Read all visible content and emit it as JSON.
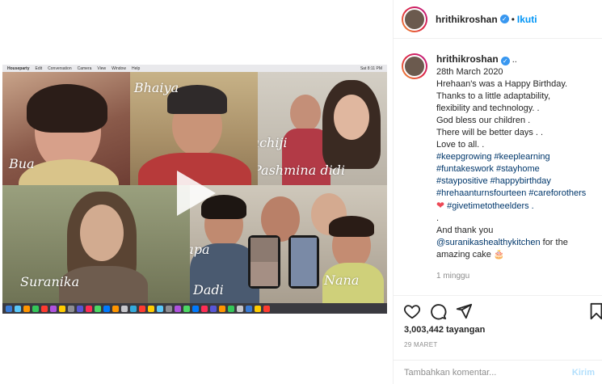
{
  "header": {
    "username": "hrithikroshan",
    "separator": "•",
    "follow_label": "Ikuti"
  },
  "video": {
    "menubar": {
      "app": "Houseparty",
      "items": [
        "Edit",
        "Conversation",
        "Camera",
        "View",
        "Window",
        "Help"
      ],
      "clock": "Sat 8:11 PM"
    },
    "labels": {
      "esha": "Esha Bhaiya",
      "bua": "Bua",
      "chachiji": "Chachiji",
      "pashmina": "Pashmina didi",
      "suranika": "Suranika",
      "guddu": "Guddu papa",
      "dadi": "Dadi",
      "nana": "Nana"
    }
  },
  "caption": {
    "username": "hrithikroshan",
    "after_name": "..",
    "lines": {
      "date": "28th March 2020",
      "l1": "Hrehaan's was a Happy Birthday.",
      "l2": "Thanks to a little adaptability,",
      "l3": "flexibility and technology. .",
      "l4": "God bless our children .",
      "l5": "There will be better days . .",
      "l6": "Love to all. .",
      "h1": "#keepgrowing #keeplearning",
      "h2": "#funtakeswork #stayhome",
      "h3": "#staypositive #happybirthday",
      "h4": "#hrehaanturnsfourteen #careforothers",
      "h5_heart": "❤",
      "h5": "#givetimetotheelders .",
      "dot": ".",
      "thanks": "And thank you",
      "mention": "@suranikashealthykitchen",
      "mention_tail": " for the",
      "cake": "amazing cake 🎂"
    },
    "time": "1 minggu"
  },
  "stats": {
    "views": "3,003,442 tayangan",
    "date": "29 MARET"
  },
  "comment": {
    "placeholder": "Tambahkan komentar...",
    "post_label": "Kirim"
  }
}
